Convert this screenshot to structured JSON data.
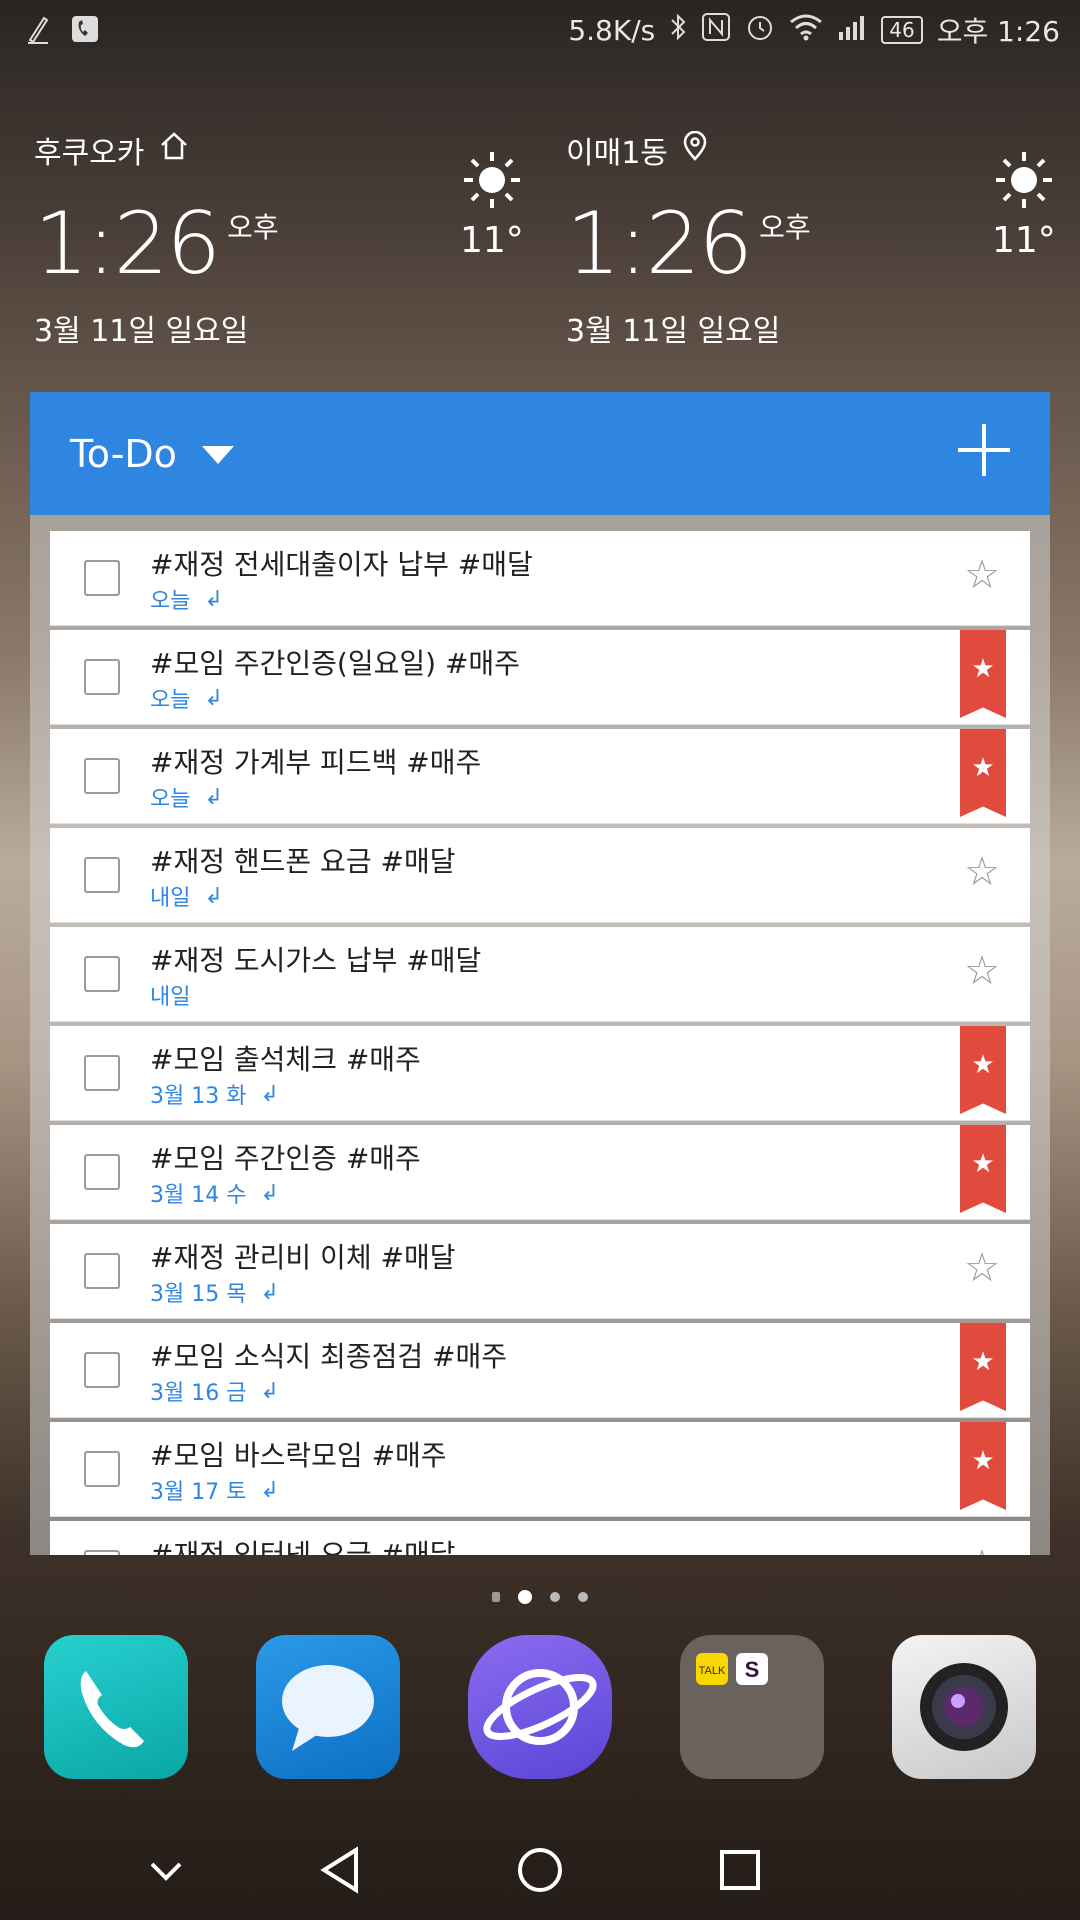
{
  "status_bar": {
    "speed": "5.8K/s",
    "battery": "46",
    "time": "오후 1:26",
    "icons": [
      "pen-icon",
      "voicemail-icon",
      "bluetooth-icon",
      "nfc-icon",
      "alarm-icon",
      "wifi-icon",
      "signal-icon",
      "battery-icon"
    ]
  },
  "clocks": [
    {
      "city": "후쿠오카",
      "city_icon": "home-icon",
      "time": "1:26",
      "ampm": "오후",
      "date": "3월 11일 일요일",
      "temp": "11°",
      "weather_icon": "sun-icon"
    },
    {
      "city": "이매1동",
      "city_icon": "location-pin-icon",
      "time": "1:26",
      "ampm": "오후",
      "date": "3월 11일 일요일",
      "temp": "11°",
      "weather_icon": "sun-icon"
    }
  ],
  "widget": {
    "title": "To-Do",
    "accent_color": "#2f86e0",
    "flag_color": "#e04b3e",
    "tasks": [
      {
        "title": "#재정 전세대출이자 납부 #매달",
        "due": "오늘",
        "repeat": true,
        "starred": false
      },
      {
        "title": "#모임 주간인증(일요일) #매주",
        "due": "오늘",
        "repeat": true,
        "starred": true
      },
      {
        "title": "#재정 가계부 피드백 #매주",
        "due": "오늘",
        "repeat": true,
        "starred": true
      },
      {
        "title": "#재정 핸드폰 요금 #매달",
        "due": "내일",
        "repeat": true,
        "starred": false
      },
      {
        "title": "#재정 도시가스 납부 #매달",
        "due": "내일",
        "repeat": false,
        "starred": false
      },
      {
        "title": "#모임 출석체크 #매주",
        "due": "3월 13 화",
        "repeat": true,
        "starred": true
      },
      {
        "title": "#모임 주간인증 #매주",
        "due": "3월 14 수",
        "repeat": true,
        "starred": true
      },
      {
        "title": "#재정 관리비 이체 #매달",
        "due": "3월 15 목",
        "repeat": true,
        "starred": false
      },
      {
        "title": "#모임 소식지 최종점검 #매주",
        "due": "3월 16 금",
        "repeat": true,
        "starred": true
      },
      {
        "title": "#모임 바스락모임 #매주",
        "due": "3월 17 토",
        "repeat": true,
        "starred": true
      },
      {
        "title": "#재정 인터넷 요금 #매달",
        "due": "",
        "repeat": false,
        "starred": false
      }
    ]
  },
  "page_indicator": {
    "pages": 4,
    "active": 1
  },
  "dock": [
    {
      "name": "phone-app",
      "icon": "phone-icon"
    },
    {
      "name": "messages-app",
      "icon": "chat-bubble-icon"
    },
    {
      "name": "internet-app",
      "icon": "planet-icon"
    },
    {
      "name": "folder",
      "icon": "folder-icon",
      "folder_labels": [
        "TALK",
        "S"
      ]
    },
    {
      "name": "camera-app",
      "icon": "camera-icon"
    }
  ],
  "nav_bar": [
    "chevron-down-icon",
    "back-icon",
    "home-icon",
    "recents-icon"
  ]
}
